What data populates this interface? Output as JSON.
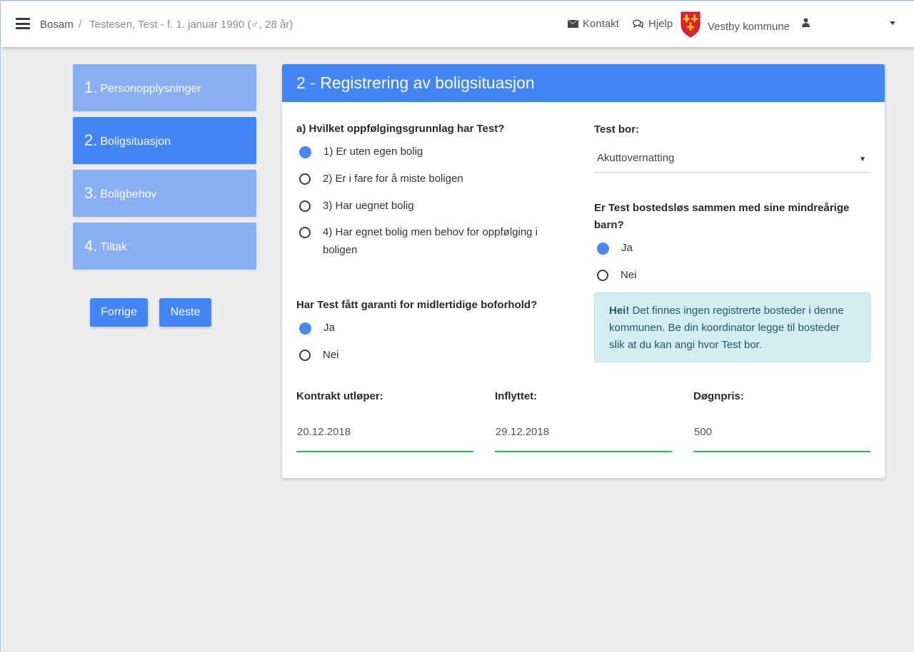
{
  "navbar": {
    "breadcrumb_home": "Bosam",
    "breadcrumb_sep": "/",
    "breadcrumb_current": "Testesen, Test - f. 1. januar 1990 (♂, 28 år)",
    "kontakt": "Kontakt",
    "hjelp": "Hjelp",
    "kommune": "Vestby kommune"
  },
  "steps": [
    {
      "num": "1.",
      "label": "Personopplysninger",
      "active": false
    },
    {
      "num": "2.",
      "label": "Boligsituasjon",
      "active": true
    },
    {
      "num": "3.",
      "label": "Boligbehov",
      "active": false
    },
    {
      "num": "4.",
      "label": "Tiltak",
      "active": false
    }
  ],
  "buttons": {
    "prev": "Forrige",
    "next": "Neste"
  },
  "card": {
    "title": "2 - Registrering av boligsituasjon",
    "q_a": {
      "label": "a) Hvilket oppfølgingsgrunnlag har Test?",
      "options": [
        "1) Er uten egen bolig",
        "2) Er i fare for å miste boligen",
        "3) Har uegnet bolig",
        "4) Har egnet bolig men behov for oppfølging i boligen"
      ],
      "selected": 0
    },
    "q_garanti": {
      "label": "Har Test fått garanti for midlertidige boforhold?",
      "options": [
        "Ja",
        "Nei"
      ],
      "selected": 0
    },
    "bor": {
      "label": "Test bor:",
      "value": "Akuttovernatting",
      "caret": "▼"
    },
    "q_barn": {
      "label": "Er Test bostedsløs sammen med sine mindreårige barn?",
      "options": [
        "Ja",
        "Nei"
      ],
      "selected": 0
    },
    "alert": {
      "strong": "Hei!",
      "text": "Det finnes ingen registrerte bosteder i denne kommunen. Be din koordinator legge til bosteder slik at du kan angi hvor Test bor."
    },
    "fields": {
      "kontrakt_label": "Kontrakt utløper:",
      "kontrakt_value": "20.12.2018",
      "inflyttet_label": "Inflyttet:",
      "inflyttet_value": "29.12.2018",
      "dognpris_label": "Døgnpris:",
      "dognpris_value": "500"
    }
  },
  "colors": {
    "primary": "#4285f4",
    "step_inactive": "#88aef4",
    "valid_underline": "#22bd4a",
    "alert_bg": "#d3ecef",
    "shield_red": "#e0202a",
    "shield_gold": "#f2c21b"
  }
}
